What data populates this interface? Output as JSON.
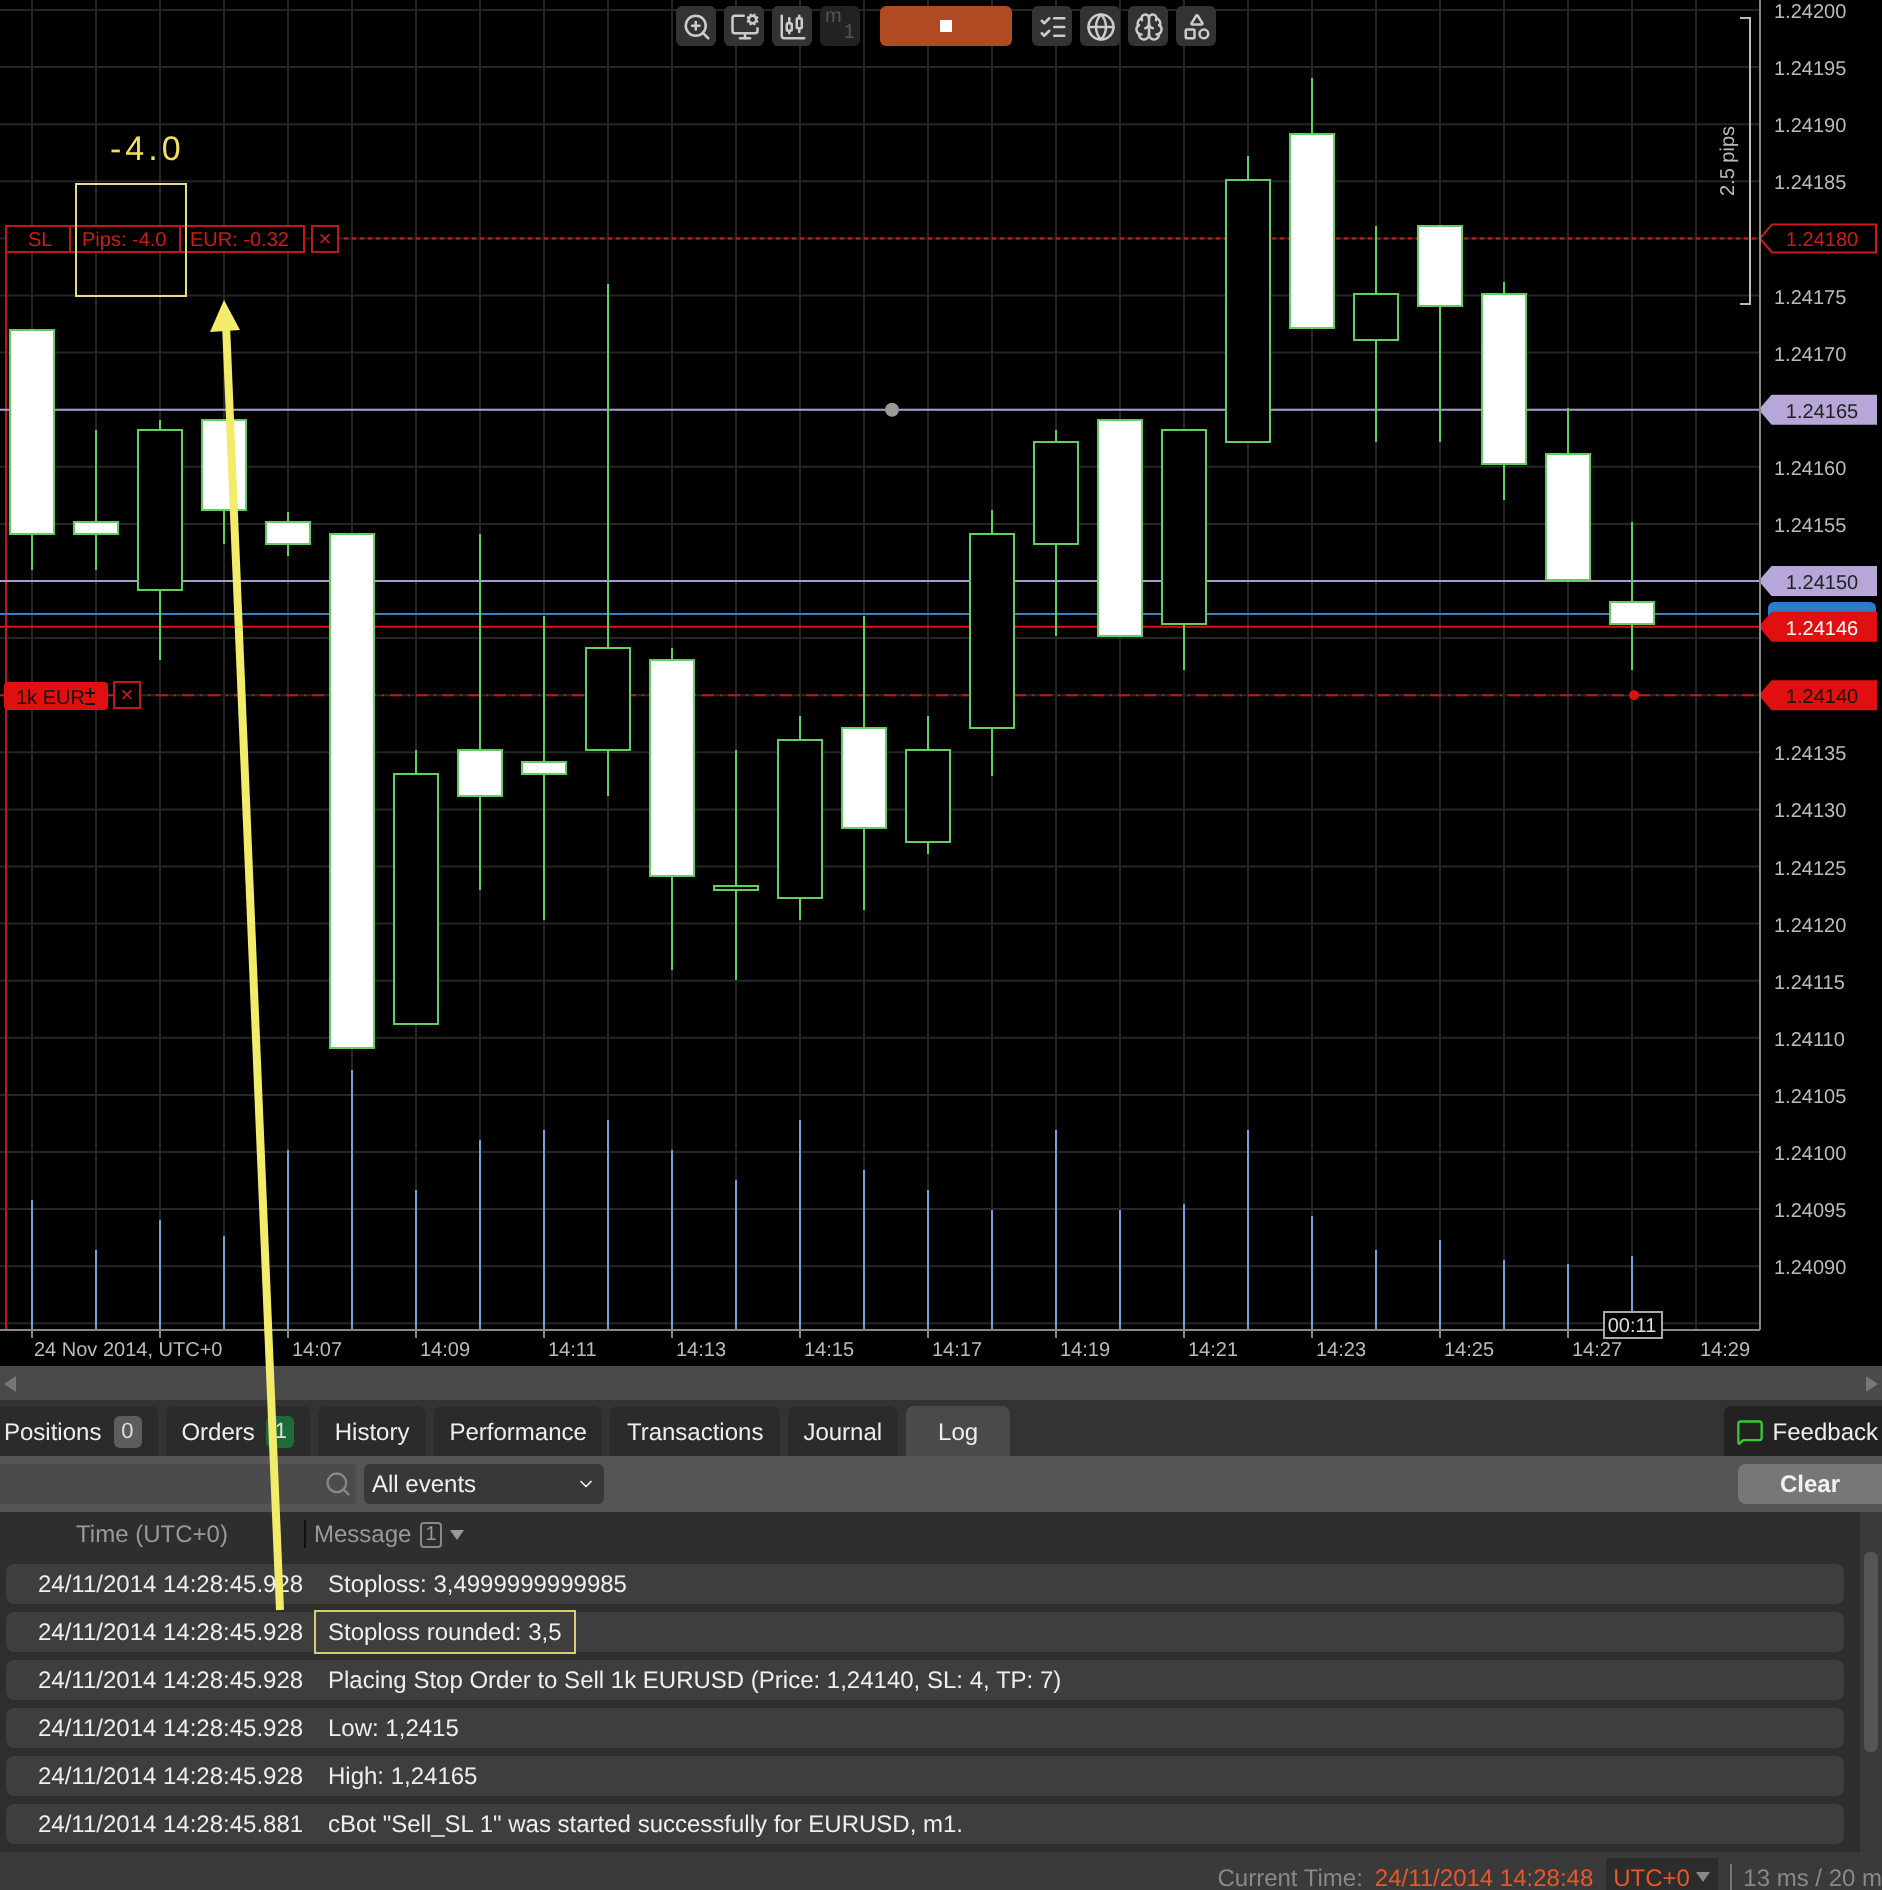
{
  "chart_toolbar": {
    "timeframe": "m",
    "timeframe_sub": "1"
  },
  "chart": {
    "price_ticks": [
      "1.24200",
      "1.24195",
      "1.24190",
      "1.24185",
      "1.24175",
      "1.24170",
      "1.24160",
      "1.24155",
      "1.24135",
      "1.24130",
      "1.24125",
      "1.24120",
      "1.24115",
      "1.24110",
      "1.24105",
      "1.24100",
      "1.24095",
      "1.24090"
    ],
    "price_markers": [
      {
        "price": "1.24180",
        "kind": "stop"
      },
      {
        "price": "1.24165",
        "kind": "line"
      },
      {
        "price": "1.24150",
        "kind": "line"
      },
      {
        "price": "1.24146",
        "kind": "bid"
      },
      {
        "price": "1.24140",
        "kind": "order"
      }
    ],
    "time_labels": [
      "24 Nov 2014, UTC+0",
      "14:07",
      "14:09",
      "14:11",
      "14:13",
      "14:15",
      "14:17",
      "14:19",
      "14:21",
      "14:23",
      "14:25",
      "14:27",
      "14:29"
    ],
    "countdown": "00:11",
    "ruler": "2.5 pips",
    "annotation": "-4.0",
    "stop_loss_tag": {
      "label": "SL",
      "pips": "Pips: -4.0",
      "amount": "EUR: -0.32",
      "close": "×"
    },
    "order_tag": {
      "label": "1k EUR",
      "close": "×"
    }
  },
  "tabs": [
    {
      "label": "Positions",
      "count": "0",
      "color": "#5c5c5c",
      "selected": false
    },
    {
      "label": "Orders",
      "count": "1",
      "color": "#1d6b3b",
      "selected": false
    },
    {
      "label": "History",
      "selected": false
    },
    {
      "label": "Performance",
      "selected": false
    },
    {
      "label": "Transactions",
      "selected": false
    },
    {
      "label": "Journal",
      "selected": false
    },
    {
      "label": "Log",
      "selected": true
    }
  ],
  "feedback": "Feedback",
  "filter": {
    "value": "All events"
  },
  "clear": "Clear",
  "log": {
    "columns": [
      "Time (UTC+0)",
      "Message"
    ],
    "message_filter_count": "1",
    "rows": [
      {
        "time": "24/11/2014 14:28:45.928",
        "message": "Stoploss: 3,4999999999985",
        "highlighted": false
      },
      {
        "time": "24/11/2014 14:28:45.928",
        "message": "Stoploss rounded: 3,5",
        "highlighted": true
      },
      {
        "time": "24/11/2014 14:28:45.928",
        "message": "Placing Stop Order to Sell 1k EURUSD (Price: 1,24140, SL: 4, TP: 7)",
        "highlighted": false
      },
      {
        "time": "24/11/2014 14:28:45.928",
        "message": "Low: 1,2415",
        "highlighted": false
      },
      {
        "time": "24/11/2014 14:28:45.928",
        "message": "High: 1,24165",
        "highlighted": false
      },
      {
        "time": "24/11/2014 14:28:45.881",
        "message": "cBot \"Sell_SL 1\" was started successfully for EURUSD, m1.",
        "highlighted": false
      }
    ]
  },
  "status": {
    "label": "Current Time:",
    "time": "24/11/2014 14:28:48",
    "timezone": "UTC+0",
    "latency": "13 ms / 20 m"
  }
}
